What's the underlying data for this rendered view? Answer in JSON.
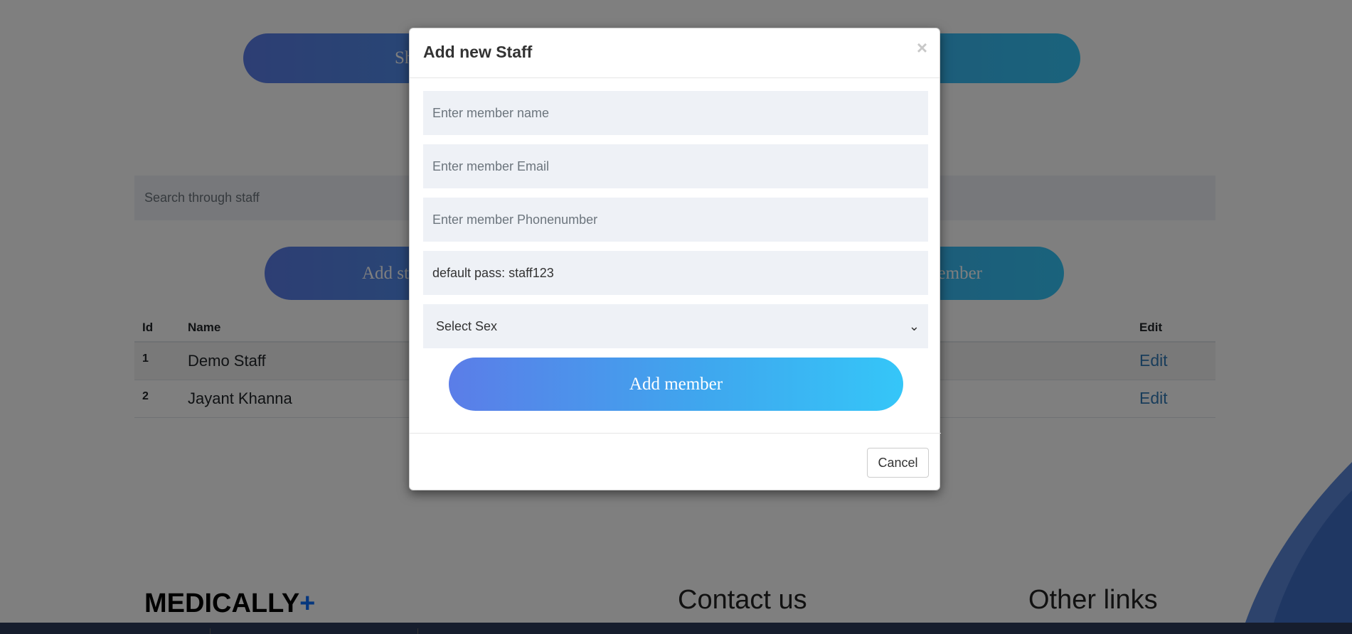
{
  "background": {
    "top_button": {
      "label_start": "Sh",
      "label_end": ""
    },
    "search": {
      "placeholder": "Search through staff"
    },
    "action_button": {
      "label_start": "Add st",
      "label_end": "ember"
    },
    "table": {
      "headers": {
        "id": "Id",
        "name": "Name",
        "edit": "Edit"
      },
      "rows": [
        {
          "id": "1",
          "name": "Demo Staff",
          "edit": "Edit"
        },
        {
          "id": "2",
          "name": "Jayant Khanna",
          "edit": "Edit"
        }
      ]
    },
    "footer": {
      "brand": "MEDICALLY",
      "brand_plus": "+",
      "contact_heading": "Contact us",
      "links_heading": "Other links"
    }
  },
  "modal": {
    "title": "Add new Staff",
    "close_glyph": "×",
    "fields": {
      "name_placeholder": "Enter member name",
      "email_placeholder": "Enter member Email",
      "phone_placeholder": "Enter member Phonenumber",
      "password_value": "default pass: staff123",
      "sex_selected": "Select Sex"
    },
    "add_button_label": "Add member",
    "cancel_label": "Cancel"
  },
  "colors": {
    "gradient_start": "#5b7de8",
    "gradient_end": "#35c6f8",
    "brand_plus": "#0d6efd",
    "edit_link": "#337ab7"
  }
}
